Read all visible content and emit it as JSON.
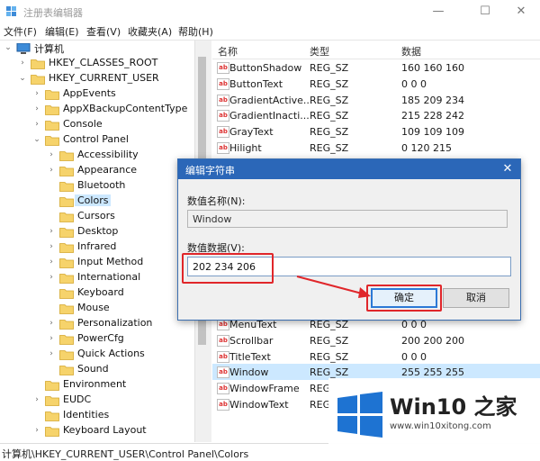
{
  "window": {
    "title": "注册表编辑器",
    "controls": [
      "—",
      "☐",
      "✕"
    ]
  },
  "menu": [
    "文件(F)",
    "编辑(E)",
    "查看(V)",
    "收藏夹(A)",
    "帮助(H)"
  ],
  "tree": [
    {
      "label": "计算机",
      "level": 0,
      "arrow": "open",
      "icon": "computer-icon"
    },
    {
      "label": "HKEY_CLASSES_ROOT",
      "level": 1,
      "arrow": "closed"
    },
    {
      "label": "HKEY_CURRENT_USER",
      "level": 1,
      "arrow": "open"
    },
    {
      "label": "AppEvents",
      "level": 2,
      "arrow": "closed"
    },
    {
      "label": "AppXBackupContentType",
      "level": 2,
      "arrow": "closed"
    },
    {
      "label": "Console",
      "level": 2,
      "arrow": "closed"
    },
    {
      "label": "Control Panel",
      "level": 2,
      "arrow": "open"
    },
    {
      "label": "Accessibility",
      "level": 3,
      "arrow": "closed"
    },
    {
      "label": "Appearance",
      "level": 3,
      "arrow": "closed"
    },
    {
      "label": "Bluetooth",
      "level": 3,
      "arrow": "none"
    },
    {
      "label": "Colors",
      "level": 3,
      "arrow": "none",
      "selected": true
    },
    {
      "label": "Cursors",
      "level": 3,
      "arrow": "none"
    },
    {
      "label": "Desktop",
      "level": 3,
      "arrow": "closed"
    },
    {
      "label": "Infrared",
      "level": 3,
      "arrow": "closed"
    },
    {
      "label": "Input Method",
      "level": 3,
      "arrow": "closed"
    },
    {
      "label": "International",
      "level": 3,
      "arrow": "closed"
    },
    {
      "label": "Keyboard",
      "level": 3,
      "arrow": "none"
    },
    {
      "label": "Mouse",
      "level": 3,
      "arrow": "none"
    },
    {
      "label": "Personalization",
      "level": 3,
      "arrow": "closed"
    },
    {
      "label": "PowerCfg",
      "level": 3,
      "arrow": "closed"
    },
    {
      "label": "Quick Actions",
      "level": 3,
      "arrow": "closed"
    },
    {
      "label": "Sound",
      "level": 3,
      "arrow": "none"
    },
    {
      "label": "Environment",
      "level": 2,
      "arrow": "none"
    },
    {
      "label": "EUDC",
      "level": 2,
      "arrow": "closed"
    },
    {
      "label": "Identities",
      "level": 2,
      "arrow": "none"
    },
    {
      "label": "Keyboard Layout",
      "level": 2,
      "arrow": "closed"
    }
  ],
  "list": {
    "headers": [
      "名称",
      "类型",
      "数据"
    ],
    "rows_top": [
      {
        "name": "ButtonShadow",
        "type": "REG_SZ",
        "data": "160 160 160"
      },
      {
        "name": "ButtonText",
        "type": "REG_SZ",
        "data": "0 0 0"
      },
      {
        "name": "GradientActive...",
        "type": "REG_SZ",
        "data": "185 209 234"
      },
      {
        "name": "GradientInacti...",
        "type": "REG_SZ",
        "data": "215 228 242"
      },
      {
        "name": "GrayText",
        "type": "REG_SZ",
        "data": "109 109 109"
      },
      {
        "name": "Hilight",
        "type": "REG_SZ",
        "data": "0 120 215"
      }
    ],
    "rows_bottom": [
      {
        "name": "MenuText",
        "type": "REG_SZ",
        "data": "0 0 0"
      },
      {
        "name": "Scrollbar",
        "type": "REG_SZ",
        "data": "200 200 200"
      },
      {
        "name": "TitleText",
        "type": "REG_SZ",
        "data": "0 0 0"
      },
      {
        "name": "Window",
        "type": "REG_SZ",
        "data": "255 255 255",
        "selected": true
      },
      {
        "name": "WindowFrame",
        "type": "REG",
        "data": ""
      },
      {
        "name": "WindowText",
        "type": "REG",
        "data": ""
      }
    ]
  },
  "status": "计算机\\HKEY_CURRENT_USER\\Control Panel\\Colors",
  "dialog": {
    "title": "编辑字符串",
    "name_label": "数值名称(N):",
    "name_value": "Window",
    "data_label": "数值数据(V):",
    "data_value": "202 234 206",
    "ok": "确定",
    "cancel": "取消",
    "close": "✕"
  },
  "watermark": {
    "title": "Win10 之家",
    "url": "www.win10xitong.com"
  },
  "colors": {
    "accent": "#2b67b8",
    "annotation": "#e0262a",
    "folder": "#f6d36b",
    "selection": "#cce8ff"
  }
}
